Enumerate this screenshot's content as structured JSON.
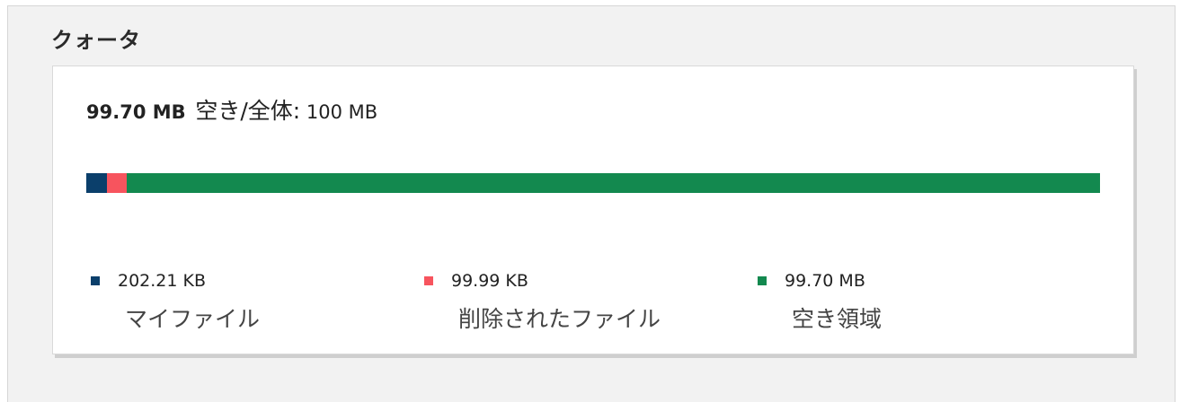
{
  "section": {
    "title": "クォータ"
  },
  "summary": {
    "free": "99.70 MB",
    "label": "空き/全体:",
    "total": "100 MB"
  },
  "usage_bar": {
    "segments": [
      {
        "key": "my_files",
        "color": "#0b3f6b",
        "fraction": 0.02
      },
      {
        "key": "deleted",
        "color": "#f7545e",
        "fraction": 0.02
      },
      {
        "key": "free",
        "color": "#13894f",
        "fraction": 0.96
      }
    ]
  },
  "legend": [
    {
      "value": "202.21 KB",
      "name": "マイファイル",
      "color": "#0b3f6b"
    },
    {
      "value": "99.99 KB",
      "name": "削除されたファイル",
      "color": "#f7545e"
    },
    {
      "value": "99.70 MB",
      "name": "空き領域",
      "color": "#13894f"
    }
  ]
}
